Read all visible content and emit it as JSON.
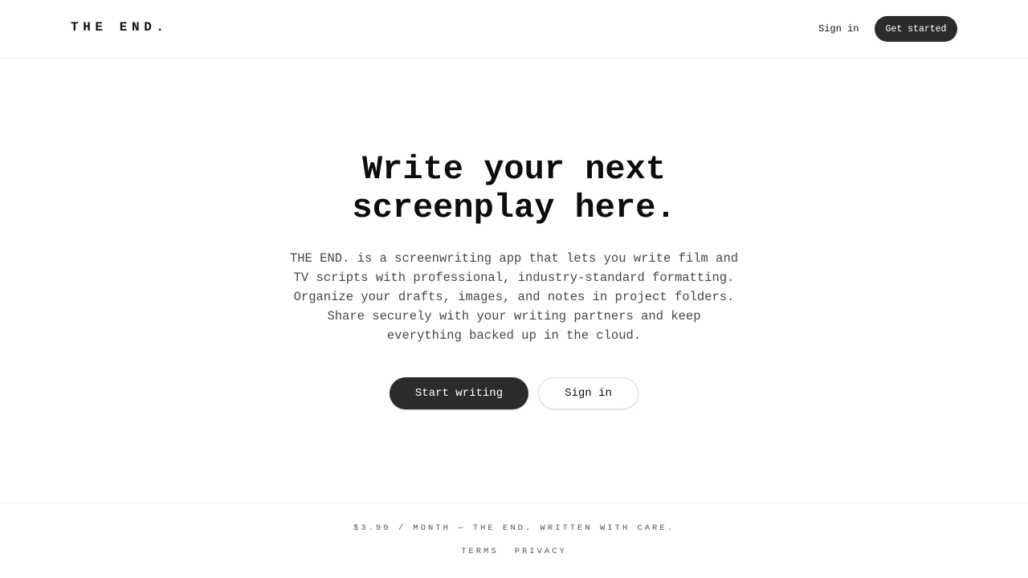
{
  "header": {
    "logo": "THE END.",
    "signin_label": "Sign in",
    "cta_label": "Get started"
  },
  "hero": {
    "title_lines": [
      "Write your next",
      "screenplay here."
    ],
    "description_lines": [
      "THE END. is a screenwriting app that lets you write film and",
      "TV scripts with professional, industry-standard formatting.",
      "Organize your drafts, images, and notes in project folders.",
      "Share securely with your writing partners and keep",
      "everything backed up in the cloud."
    ],
    "primary_button": "Start writing",
    "secondary_button": "Sign in"
  },
  "footer": {
    "tagline": "$3.99 / MONTH — THE END. WRITTEN WITH CARE.",
    "links": [
      "TERMS",
      "PRIVACY"
    ]
  },
  "colors": {
    "primary_button_bg": "#2b2b2b",
    "text": "#111111",
    "muted_text": "#474747",
    "divider": "#ececec"
  }
}
